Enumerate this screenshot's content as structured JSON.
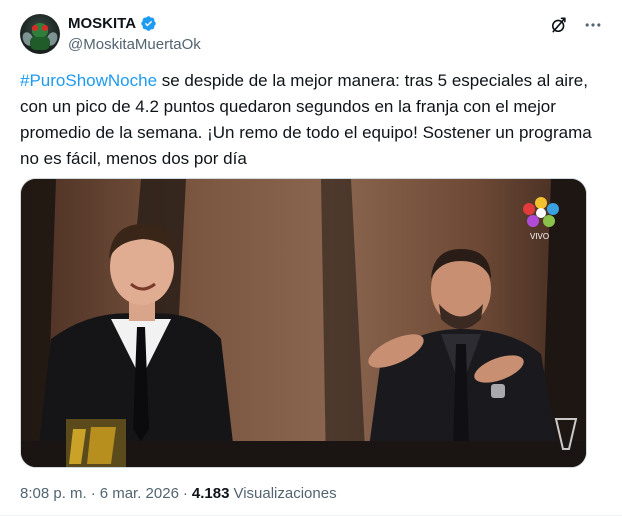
{
  "author": {
    "display_name": "MOSKITA",
    "handle": "@MoskitaMuertaOk",
    "verified": true
  },
  "actions": {
    "grok_icon": "grok-slash-icon",
    "more_icon": "more-dots-icon"
  },
  "tweet": {
    "hashtag": "#PuroShowNoche",
    "text_rest": " se despide de la mejor manera: tras 5 especiales al aire, con un pico de 4.2 puntos quedaron segundos en la franja con el mejor promedio de la semana. ¡Un remo de todo el equipo! Sostener un programa no es fácil, menos dos por día"
  },
  "media": {
    "live_label": "VIVO"
  },
  "meta": {
    "time": "8:08 p. m.",
    "separator": "·",
    "date": "6 mar. 2026",
    "views_count": "4.183",
    "views_label": "Visualizaciones"
  },
  "colors": {
    "accent": "#1d9bf0",
    "verified": "#1d9bf0",
    "secondary_text": "#536471"
  }
}
